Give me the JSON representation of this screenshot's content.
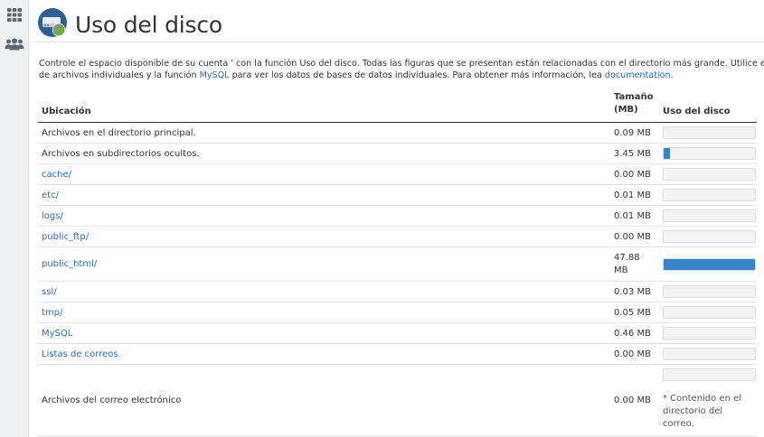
{
  "sidebar": {
    "items": [
      {
        "icon": "grid-icon"
      },
      {
        "icon": "users-icon"
      }
    ]
  },
  "header": {
    "title": "Uso del disco",
    "icon": "disk-usage-icon"
  },
  "description": {
    "line1": "Controle el espacio disponible de su cuenta ' con la función Uso del disco. Todas las figuras que se presentan están relacionadas con el directorio más grande. Utilice el",
    "line2_a": "de archivos individuales y la función ",
    "line2_link1": "MySQL",
    "line2_b": " para ver los datos de bases de datos individuales. Para obtener más información, lea ",
    "line2_link2": "documentation",
    "line2_c": "."
  },
  "table": {
    "headers": {
      "location": "Ubicación",
      "size_line1": "Tamaño",
      "size_line2": "(MB)",
      "usage": "Uso del disco"
    },
    "rows": [
      {
        "location": "Archivos en el directorio principal.",
        "size": "0.09 MB",
        "link": false,
        "fill": 0
      },
      {
        "location": "Archivos en subdirectorios ocultos.",
        "size": "3.45 MB",
        "link": false,
        "fill": 0.072
      },
      {
        "location": "cache/",
        "size": "0.00 MB",
        "link": true,
        "fill": 0
      },
      {
        "location": "etc/",
        "size": "0.01 MB",
        "link": true,
        "fill": 0
      },
      {
        "location": "logs/",
        "size": "0.01 MB",
        "link": true,
        "fill": 0
      },
      {
        "location": "public_ftp/",
        "size": "0.00 MB",
        "link": true,
        "fill": 0
      },
      {
        "location": "public_html/",
        "size_line1": "47.88",
        "size_line2": "MB",
        "link": true,
        "fill": 1.0
      },
      {
        "location": "ssl/",
        "size": "0.03 MB",
        "link": true,
        "fill": 0
      },
      {
        "location": "tmp/",
        "size": "0.05 MB",
        "link": true,
        "fill": 0
      },
      {
        "location": "MySQL",
        "size": "0.46 MB",
        "link": true,
        "fill": 0
      },
      {
        "location": "Listas de correos",
        "size": "0.00 MB",
        "link": true,
        "fill": 0
      },
      {
        "location": "Archivos del correo electrónico",
        "size": "0.00 MB",
        "link": false,
        "fill": 0,
        "note": "* Contenido en el directorio del correo."
      }
    ]
  },
  "colors": {
    "accent": "#3782c9",
    "link": "#2a6bbf",
    "sidebar_bg": "#eef0f2"
  }
}
